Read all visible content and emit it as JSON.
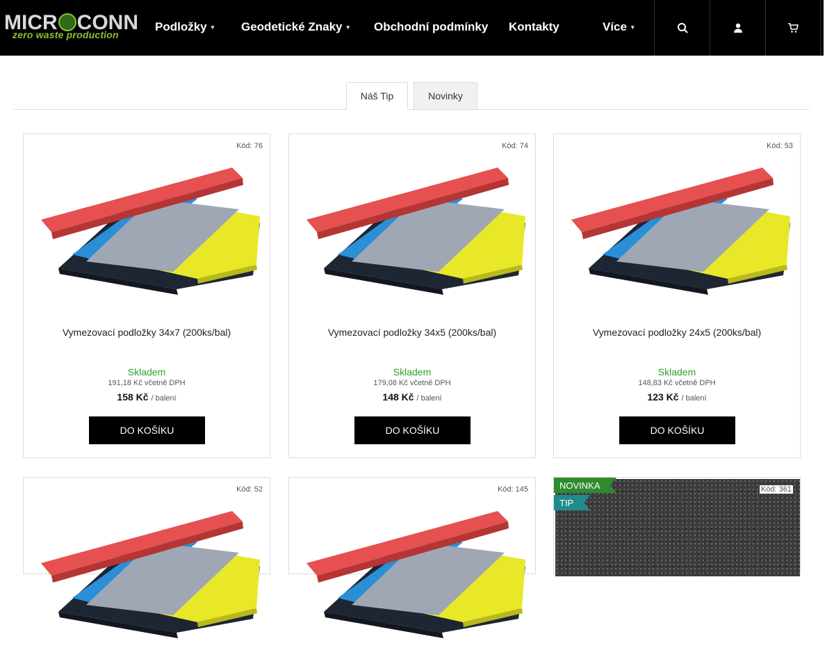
{
  "header": {
    "logo_text": "MICROCONN",
    "logo_tagline": "zero waste production",
    "nav": [
      {
        "label": "Podložky",
        "has_dropdown": true
      },
      {
        "label": "Geodetické Znaky",
        "has_dropdown": true
      },
      {
        "label": "Obchodní podmínky",
        "has_dropdown": false
      },
      {
        "label": "Kontakty",
        "has_dropdown": false
      },
      {
        "label": "Více",
        "has_dropdown": true
      }
    ],
    "buttons": [
      {
        "icon": "search-icon"
      },
      {
        "icon": "user-icon"
      },
      {
        "icon": "cart-icon"
      }
    ]
  },
  "tabs": [
    {
      "label": "Náš Tip",
      "active": true
    },
    {
      "label": "Novinky",
      "active": false
    }
  ],
  "products": [
    {
      "code": "Kód: 76",
      "name": "Vymezovací podložky 34x7 (200ks/bal)",
      "stock": "Skladem",
      "price_vat": "191,18 Kč včetně DPH",
      "price": "158 Kč",
      "unit": "/ balení",
      "cart_label": "Do košíku"
    },
    {
      "code": "Kód: 74",
      "name": "Vymezovací podložky 34x5 (200ks/bal)",
      "stock": "Skladem",
      "price_vat": "179,08 Kč včetně DPH",
      "price": "148 Kč",
      "unit": "/ balení",
      "cart_label": "Do košíku"
    },
    {
      "code": "Kód: 53",
      "name": "Vymezovací podložky 24x5 (200ks/bal)",
      "stock": "Skladem",
      "price_vat": "148,83 Kč včetně DPH",
      "price": "123 Kč",
      "unit": "/ balení",
      "cart_label": "Do košíku"
    },
    {
      "code": "Kód: 52"
    },
    {
      "code": "Kód: 145"
    },
    {
      "code": "Kód: 361",
      "badges": [
        "NOVINKA",
        "TIP"
      ]
    }
  ],
  "colors": {
    "header_bg": "#000000",
    "stock_green": "#2aa12a",
    "badge_new": "#2e8b2e",
    "badge_tip": "#1f8c8c"
  }
}
